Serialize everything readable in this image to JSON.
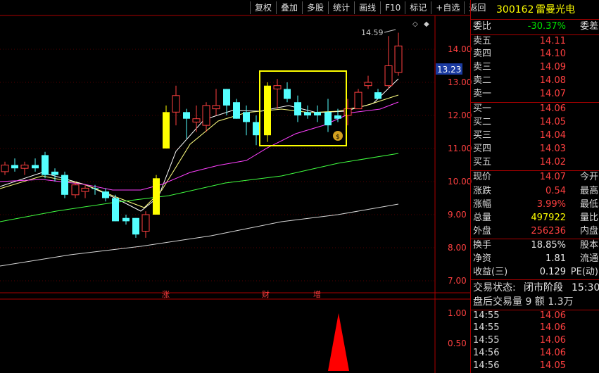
{
  "toolbar": [
    "复权",
    "叠加",
    "多股",
    "统计",
    "画线",
    "F10",
    "标记",
    "+自选",
    "返回"
  ],
  "stock": {
    "code": "300162",
    "name": "雷曼光电"
  },
  "price_label": "13.23",
  "high_marker": "14.59",
  "price_ticks": [
    "14.00",
    "13.00",
    "12.00",
    "11.00",
    "10.00",
    "9.00",
    "8.00",
    "7.00"
  ],
  "vol_ticks": [
    "1.00",
    "0.50"
  ],
  "markers": [
    "涨",
    "财",
    "增"
  ],
  "weibi": {
    "label": "委比",
    "value": "-30.37%",
    "label2": "委差"
  },
  "asks": [
    {
      "label": "卖五",
      "price": "14.11"
    },
    {
      "label": "卖四",
      "price": "14.10"
    },
    {
      "label": "卖三",
      "price": "14.09"
    },
    {
      "label": "卖二",
      "price": "14.08"
    },
    {
      "label": "卖一",
      "price": "14.07"
    }
  ],
  "bids": [
    {
      "label": "买一",
      "price": "14.06"
    },
    {
      "label": "买二",
      "price": "14.05"
    },
    {
      "label": "买三",
      "price": "14.04"
    },
    {
      "label": "买四",
      "price": "14.03"
    },
    {
      "label": "买五",
      "price": "14.02"
    }
  ],
  "stats1": [
    {
      "label": "现价",
      "value": "14.07",
      "label2": "今开"
    },
    {
      "label": "涨跌",
      "value": "0.54",
      "label2": "最高"
    },
    {
      "label": "涨幅",
      "value": "3.99%",
      "label2": "最低"
    },
    {
      "label": "总量",
      "value": "497922",
      "label2": "量比"
    },
    {
      "label": "外盘",
      "value": "256236",
      "label2": "内盘"
    }
  ],
  "stats2": [
    {
      "label": "换手",
      "value": "18.85%",
      "label2": "股本"
    },
    {
      "label": "净资",
      "value": "1.81",
      "label2": "流通"
    },
    {
      "label": "收益(三)",
      "value": "0.129",
      "label2": "PE(动)"
    }
  ],
  "trade_status": {
    "label": "交易状态:",
    "value": "闭市阶段",
    "time": "15:30:"
  },
  "after_hours": "盘后交易量 9 额 1.3万",
  "ticks": [
    {
      "time": "14:55",
      "price": "14.06"
    },
    {
      "time": "14:55",
      "price": "14.06"
    },
    {
      "time": "14:55",
      "price": "14.06"
    },
    {
      "time": "14:56",
      "price": "14.06"
    },
    {
      "time": "14:56",
      "price": "14.05"
    }
  ]
}
